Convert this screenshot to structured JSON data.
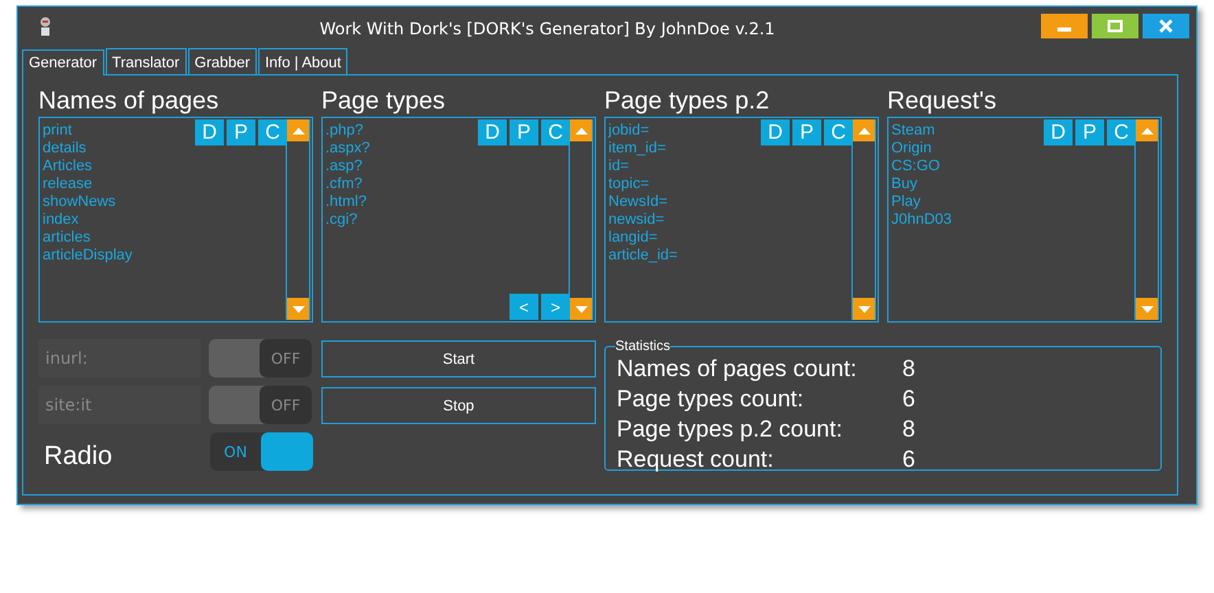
{
  "window": {
    "title": "Work With Dork's [DORK's Generator] By JohnDoe v.2.1",
    "controls": [
      {
        "kind": "minimize"
      },
      {
        "kind": "maximize"
      },
      {
        "kind": "close"
      }
    ]
  },
  "tabs": [
    {
      "label": "Generator",
      "selected": true
    },
    {
      "label": "Translator",
      "selected": false
    },
    {
      "label": "Grabber",
      "selected": false
    },
    {
      "label": "Info | About",
      "selected": false
    }
  ],
  "lists": [
    {
      "title": "Names of pages",
      "actions": [
        "D",
        "P",
        "C"
      ],
      "items": [
        "print",
        "details",
        "Articles",
        "release",
        "showNews",
        "index",
        "articles",
        "articleDisplay"
      ]
    },
    {
      "title": "Page types",
      "actions": [
        "D",
        "P",
        "C"
      ],
      "items": [
        ".php?",
        ".aspx?",
        ".asp?",
        ".cfm?",
        ".html?",
        ".cgi?"
      ],
      "nav": [
        "<",
        ">"
      ]
    },
    {
      "title": "Page types p.2",
      "actions": [
        "D",
        "P",
        "C"
      ],
      "items": [
        "jobid=",
        "item_id=",
        "id=",
        "topic=",
        "NewsId=",
        "newsid=",
        "langid=",
        "article_id="
      ]
    },
    {
      "title": "Request's",
      "actions": [
        "D",
        "P",
        "C"
      ],
      "items": [
        "Steam",
        "Origin",
        "CS:GO",
        "Buy",
        "Play",
        "J0hnD03"
      ]
    }
  ],
  "options": [
    {
      "kind": "field",
      "value": "inurl:",
      "disabled": true,
      "toggle": {
        "label": "OFF",
        "on": false
      }
    },
    {
      "kind": "field",
      "value": "site:it",
      "disabled": true,
      "toggle": {
        "label": "OFF",
        "on": false
      }
    },
    {
      "kind": "label",
      "text": "Radio",
      "toggle": {
        "label": "ON",
        "on": true
      }
    }
  ],
  "buttons": [
    "Start",
    "Stop"
  ],
  "statistics": {
    "title": "Statistics",
    "rows": [
      {
        "label": "Names of pages count:",
        "value": "8"
      },
      {
        "label": "Page types count:",
        "value": "6"
      },
      {
        "label": "Page types p.2 count:",
        "value": "8"
      },
      {
        "label": "Request count:",
        "value": "6"
      }
    ]
  }
}
